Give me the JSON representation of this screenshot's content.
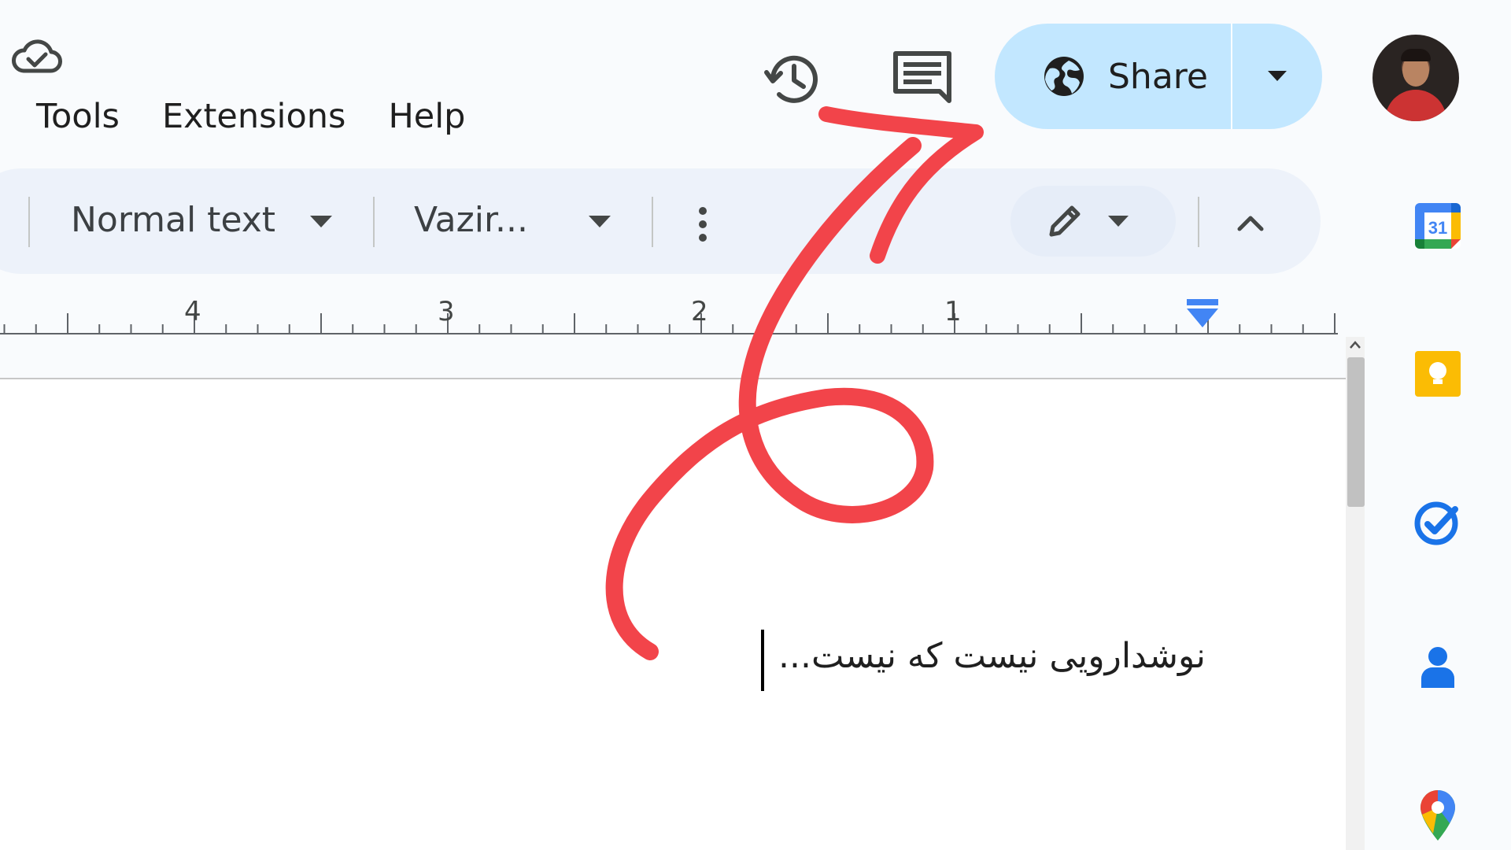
{
  "header": {
    "menu": [
      "Tools",
      "Extensions",
      "Help"
    ],
    "share_label": "Share"
  },
  "toolbar": {
    "style_select": "Normal text",
    "font_select": "Vazir..."
  },
  "ruler": {
    "numbers": [
      "4",
      "3",
      "2",
      "1"
    ]
  },
  "document": {
    "text": "نوشدارویی نیست که نیست..."
  },
  "icons": {
    "save_status": "cloud-done-icon",
    "history": "history-icon",
    "comments": "comments-icon",
    "share": "globe-icon",
    "edit_mode": "pencil-icon",
    "side_apps": [
      "calendar-icon",
      "keep-icon",
      "tasks-icon",
      "contacts-icon",
      "maps-icon"
    ]
  },
  "colors": {
    "share_bg": "#c2e7ff",
    "toolbar_bg": "#edf2fa",
    "annotation_arrow": "#f2444a",
    "indent_marker": "#4285f4"
  }
}
